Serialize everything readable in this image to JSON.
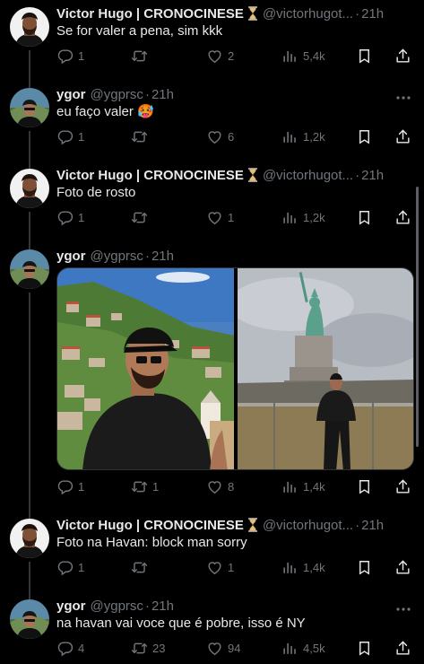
{
  "tweets": [
    {
      "name": "Victor Hugo | CRONOCINESE",
      "handle": "@victorhugot...",
      "time": "21h",
      "text": "Se for valer a pena, sim kkk",
      "replies": "1",
      "retweets": "",
      "likes": "2",
      "views": "5,4k"
    },
    {
      "name": "ygor",
      "handle": "@ygprsc",
      "time": "21h",
      "text": "eu faço valer 🥵",
      "replies": "1",
      "retweets": "",
      "likes": "6",
      "views": "1,2k"
    },
    {
      "name": "Victor Hugo | CRONOCINESE",
      "handle": "@victorhugot...",
      "time": "21h",
      "text": "Foto de rosto",
      "replies": "1",
      "retweets": "",
      "likes": "1",
      "views": "1,2k"
    },
    {
      "name": "ygor",
      "handle": "@ygprsc",
      "time": "21h",
      "text": "",
      "replies": "1",
      "retweets": "1",
      "likes": "8",
      "views": "1,4k"
    },
    {
      "name": "Victor Hugo | CRONOCINESE",
      "handle": "@victorhugot...",
      "time": "21h",
      "text": "Foto na Havan: block man sorry",
      "replies": "1",
      "retweets": "",
      "likes": "1",
      "views": "1,4k"
    },
    {
      "name": "ygor",
      "handle": "@ygprsc",
      "time": "21h",
      "text": "na havan vai voce que é pobre, isso é NY",
      "replies": "4",
      "retweets": "23",
      "likes": "94",
      "views": "4,5k"
    }
  ],
  "icons": {
    "reply": "reply-icon",
    "retweet": "retweet-icon",
    "like": "heart-icon",
    "views": "views-icon",
    "bookmark": "bookmark-icon",
    "share": "share-icon",
    "more": "more-icon",
    "hourglass": "hourglass-icon"
  },
  "colors": {
    "background": "#000000",
    "text": "#e7e9ea",
    "secondary": "#71767b"
  }
}
